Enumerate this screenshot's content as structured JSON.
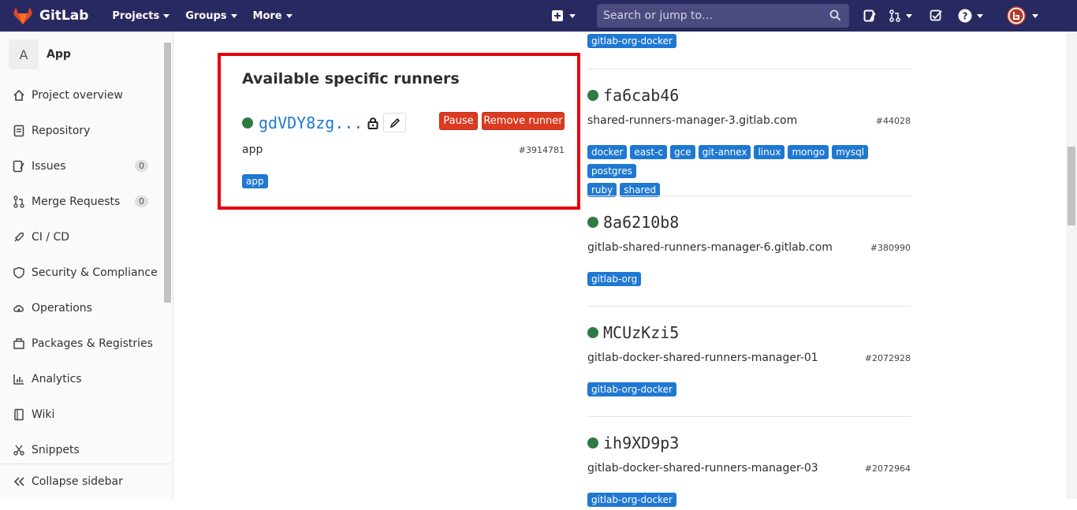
{
  "navbar": {
    "brand": "GitLab",
    "menu": [
      {
        "label": "Projects"
      },
      {
        "label": "Groups"
      },
      {
        "label": "More"
      }
    ],
    "search_placeholder": "Search or jump to…",
    "colors": {
      "bg": "#292961",
      "search_bg": "#4b4b80"
    }
  },
  "sidebar": {
    "project_initial": "A",
    "project_name": "App",
    "items": [
      {
        "label": "Project overview",
        "icon": "home-icon"
      },
      {
        "label": "Repository",
        "icon": "doc-icon"
      },
      {
        "label": "Issues",
        "icon": "issues-icon",
        "count": "0"
      },
      {
        "label": "Merge Requests",
        "icon": "merge-request-icon",
        "count": "0"
      },
      {
        "label": "CI / CD",
        "icon": "rocket-icon"
      },
      {
        "label": "Security & Compliance",
        "icon": "shield-icon"
      },
      {
        "label": "Operations",
        "icon": "cloud-gear-icon"
      },
      {
        "label": "Packages & Registries",
        "icon": "package-icon"
      },
      {
        "label": "Analytics",
        "icon": "chart-icon"
      },
      {
        "label": "Wiki",
        "icon": "book-icon"
      },
      {
        "label": "Snippets",
        "icon": "scissors-icon"
      }
    ],
    "collapse_label": "Collapse sidebar"
  },
  "specific_runners": {
    "title": "Available specific runners",
    "runner": {
      "token": "gdVDY8zg...",
      "description": "app",
      "id": "#3914781",
      "tags": [
        "app"
      ],
      "pause_label": "Pause",
      "remove_label": "Remove runner",
      "status_color": "#2f7a44"
    },
    "highlight_color": "#e8000d"
  },
  "shared_runners": [
    {
      "token": "",
      "description": "",
      "id": "",
      "tags": [
        "gitlab-org-docker"
      ]
    },
    {
      "token": "fa6cab46",
      "description": "shared-runners-manager-3.gitlab.com",
      "id": "#44028",
      "tags": [
        "docker",
        "east-c",
        "gce",
        "git-annex",
        "linux",
        "mongo",
        "mysql",
        "postgres",
        "ruby",
        "shared"
      ]
    },
    {
      "token": "8a6210b8",
      "description": "gitlab-shared-runners-manager-6.gitlab.com",
      "id": "#380990",
      "tags": [
        "gitlab-org"
      ]
    },
    {
      "token": "MCUzKzi5",
      "description": "gitlab-docker-shared-runners-manager-01",
      "id": "#2072928",
      "tags": [
        "gitlab-org-docker"
      ]
    },
    {
      "token": "ih9XD9p3",
      "description": "gitlab-docker-shared-runners-manager-03",
      "id": "#2072964",
      "tags": [
        "gitlab-org-docker"
      ]
    }
  ]
}
